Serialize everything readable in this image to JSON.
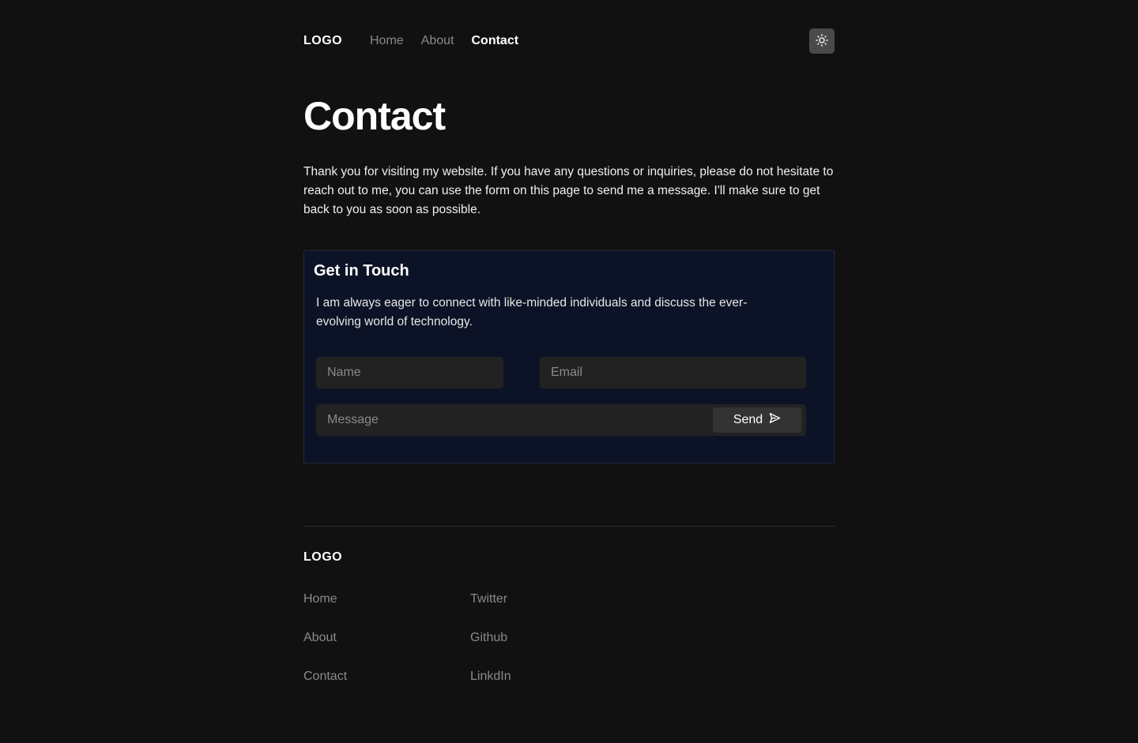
{
  "header": {
    "logo": "LOGO",
    "nav": [
      {
        "label": "Home",
        "active": false
      },
      {
        "label": "About",
        "active": false
      },
      {
        "label": "Contact",
        "active": true
      }
    ],
    "theme_toggle_icon": "sun-icon"
  },
  "main": {
    "title": "Contact",
    "intro": "Thank you for visiting my website. If you have any questions or inquiries, please do not hesitate to reach out to me, you can use the form on this page to send me a message. I'll make sure to get back to you as soon as possible."
  },
  "card": {
    "title": "Get in Touch",
    "description": "I am always eager to connect with like-minded individuals and discuss the ever-evolving world of technology.",
    "form": {
      "name_placeholder": "Name",
      "email_placeholder": "Email",
      "message_placeholder": "Message",
      "send_label": "Send",
      "send_icon": "send-icon"
    }
  },
  "footer": {
    "logo": "LOGO",
    "col1": [
      "Home",
      "About",
      "Contact"
    ],
    "col2": [
      "Twitter",
      "Github",
      "LinkdIn"
    ]
  },
  "colors": {
    "background": "#111111",
    "card_background": "#0d1326",
    "input_background": "#222222",
    "muted_text": "#8a8a8a"
  }
}
